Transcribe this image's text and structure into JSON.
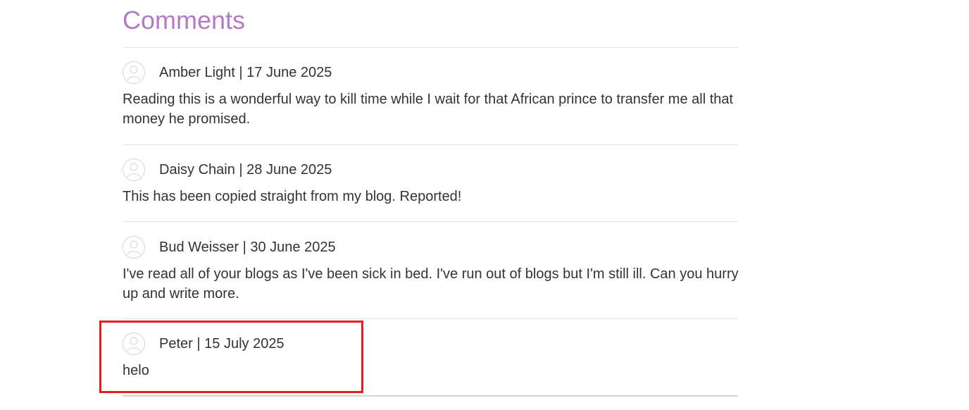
{
  "section": {
    "title": "Comments"
  },
  "comments": [
    {
      "author": "Amber Light",
      "separator": "|",
      "date": "17 June 2025",
      "text": "Reading this is a wonderful way to kill time while I wait for that African prince to transfer me all that money he promised."
    },
    {
      "author": "Daisy Chain",
      "separator": "|",
      "date": "28 June 2025",
      "text": "This has been copied straight from my blog. Reported!"
    },
    {
      "author": "Bud Weisser",
      "separator": "|",
      "date": "30 June 2025",
      "text": "I've read all of your blogs as I've been sick in bed. I've run out of blogs but I'm still ill. Can you hurry up and write more."
    },
    {
      "author": "Peter",
      "separator": "|",
      "date": "15 July 2025",
      "text": "helo"
    }
  ],
  "icons": {
    "avatar": "user-avatar-icon"
  },
  "colors": {
    "title": "#b679c6",
    "text": "#333333",
    "highlight": "#e0211f",
    "divider": "#e6e6e6"
  }
}
